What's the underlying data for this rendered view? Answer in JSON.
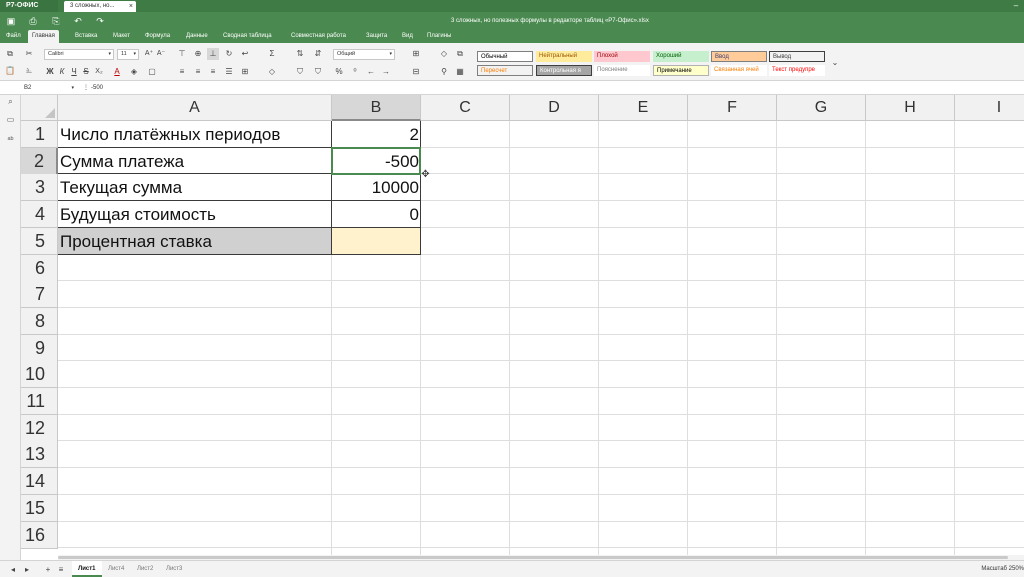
{
  "app": {
    "brand": "Р7-ОФИС",
    "doc_tab": "3 сложных, но...",
    "doc_tab_close": "×",
    "file_title": "3 сложных, но полезных формулы в редакторе таблиц «Р7-Офис».xlsx"
  },
  "menu": {
    "items": [
      "Файл",
      "Главная",
      "Вставка",
      "Макет",
      "Формула",
      "Данные",
      "Сводная таблица",
      "Совместная работа",
      "Защита",
      "Вид",
      "Плагины"
    ],
    "active": "Главная"
  },
  "toolbar": {
    "font_name": "Calibri",
    "font_size": "11",
    "number_format": "Общий",
    "bold": "Ж",
    "italic": "К",
    "underline": "Ч",
    "strike": "S",
    "sub": "X₂",
    "font_color": "A",
    "increase_font": "A⁺",
    "decrease_font": "A⁻"
  },
  "styles": [
    {
      "label": "Обычный",
      "bg": "#ffffff",
      "color": "#000000",
      "border": "#7f7f7f"
    },
    {
      "label": "Нейтральный",
      "bg": "#ffeb9c",
      "color": "#9c5700",
      "border": ""
    },
    {
      "label": "Плохой",
      "bg": "#ffc7ce",
      "color": "#9c0006",
      "border": ""
    },
    {
      "label": "Хороший",
      "bg": "#c6efce",
      "color": "#006100",
      "border": ""
    },
    {
      "label": "Ввод",
      "bg": "#ffcc99",
      "color": "#3f3f76",
      "border": "#7f7f7f"
    },
    {
      "label": "Вывод",
      "bg": "#f2f2f2",
      "color": "#3f3f3f",
      "border": "#3f3f3f"
    },
    {
      "label": "Пересчет",
      "bg": "#f2f2f2",
      "color": "#fa7d00",
      "border": "#7f7f7f"
    },
    {
      "label": "Контрольная я",
      "bg": "#a5a5a5",
      "color": "#ffffff",
      "border": "#3f3f3f"
    },
    {
      "label": "Пояснение",
      "bg": "#ffffff",
      "color": "#7f7f7f",
      "border": ""
    },
    {
      "label": "Примечание",
      "bg": "#ffffcc",
      "color": "#000000",
      "border": "#b2b2b2"
    },
    {
      "label": "Связанная ячей",
      "bg": "#ffffff",
      "color": "#fa7d00",
      "border": ""
    },
    {
      "label": "Текст предупре",
      "bg": "#ffffff",
      "color": "#ff0000",
      "border": ""
    }
  ],
  "formula_bar": {
    "cell_ref": "B2",
    "value": "-500"
  },
  "grid": {
    "columns": [
      "A",
      "B",
      "C",
      "D",
      "E",
      "F",
      "G",
      "H",
      "I"
    ],
    "selected_column": "B",
    "rows": [
      "1",
      "2",
      "3",
      "4",
      "5",
      "6",
      "7",
      "8",
      "9",
      "10",
      "11",
      "12",
      "13",
      "14",
      "15",
      "16"
    ],
    "selected_row": "2",
    "cells": [
      {
        "label": "Число платёжных периодов",
        "value": "2"
      },
      {
        "label": "Сумма платежа",
        "value": "-500"
      },
      {
        "label": "Текущая сумма",
        "value": "10000"
      },
      {
        "label": "Будущая стоимость",
        "value": "0"
      },
      {
        "label": "Процентная ставка",
        "value": ""
      }
    ],
    "highlight_colors": {
      "label_row5": "#d0d0d0",
      "value_row5": "#fff2cc",
      "selection": "#4a8a50"
    }
  },
  "sheets": {
    "tabs": [
      "Лист1",
      "Лист4",
      "Лист2",
      "Лист3"
    ],
    "active": "Лист1"
  },
  "status": {
    "zoom": "Масштаб 250%"
  }
}
